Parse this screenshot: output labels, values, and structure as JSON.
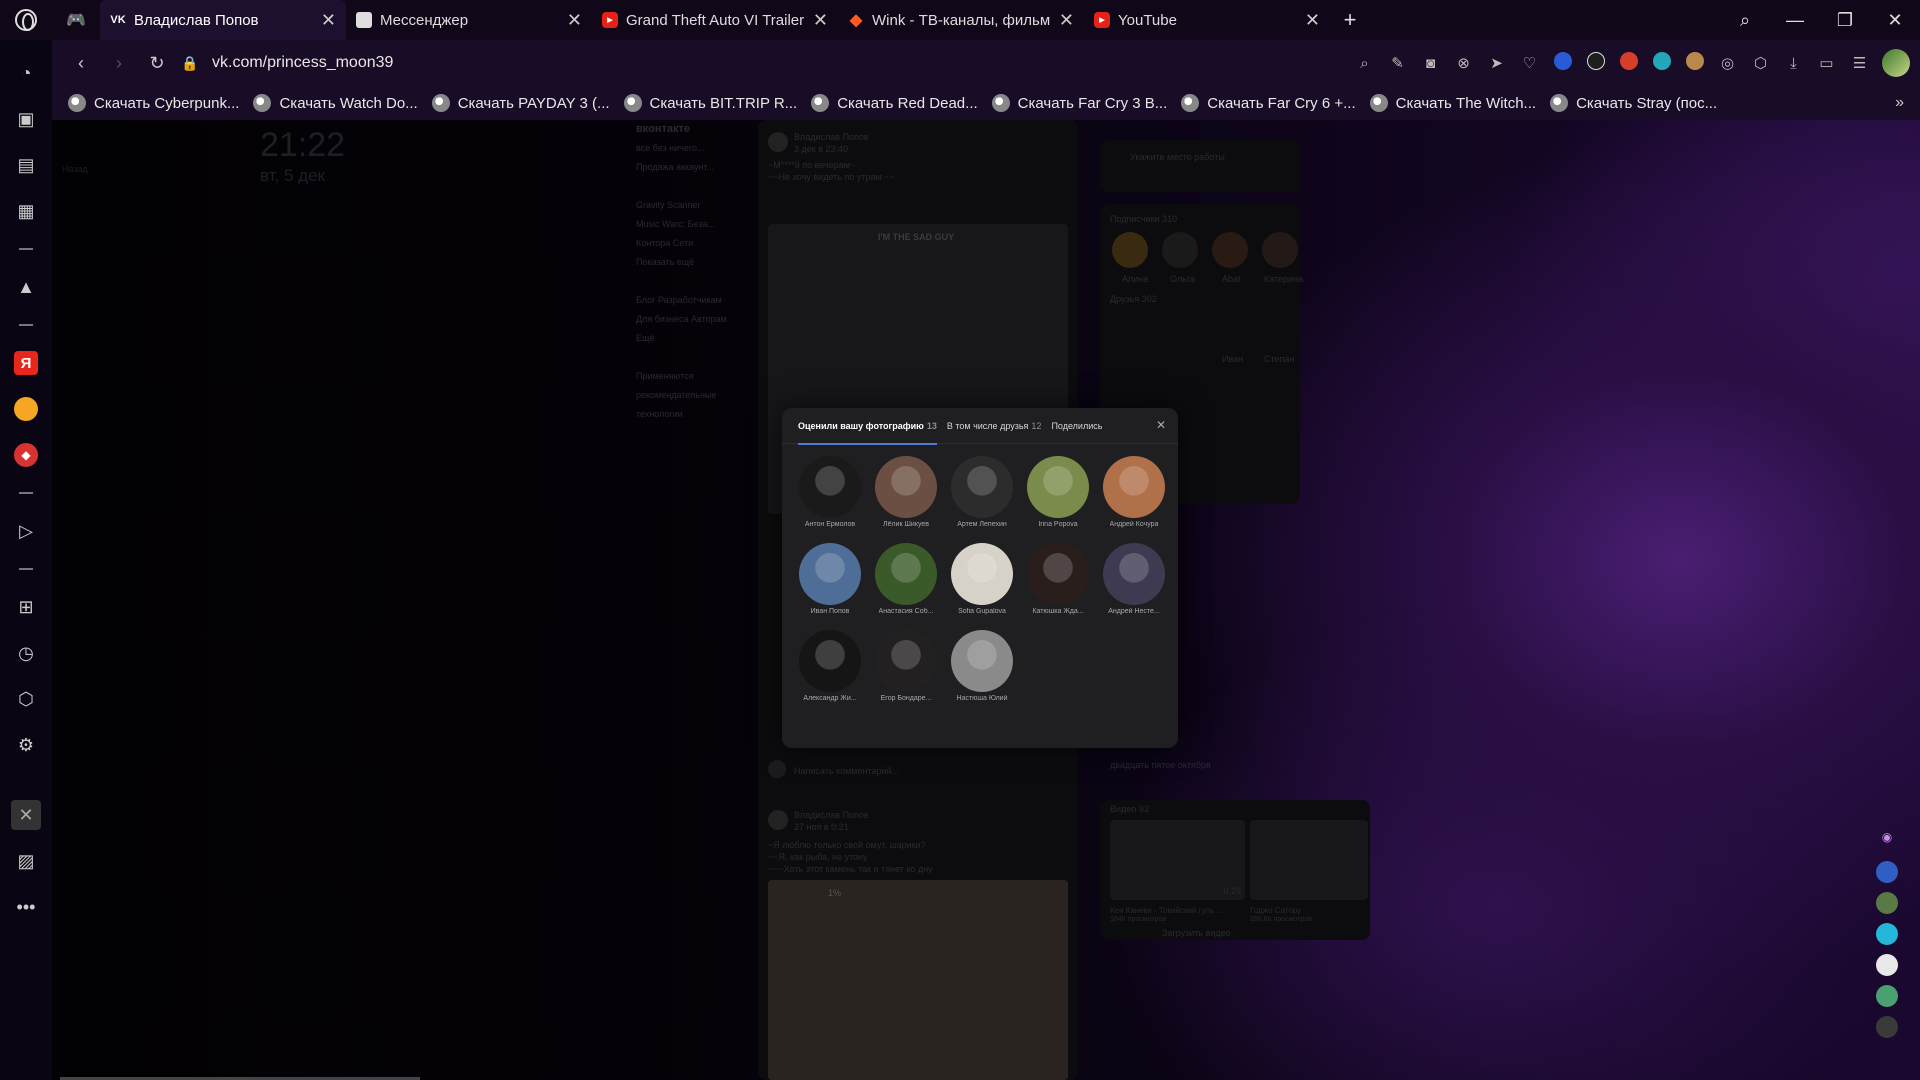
{
  "tabs": [
    {
      "label": "Владислав Попов",
      "favicon": "vk-icon",
      "active": true
    },
    {
      "label": "Мессенджер",
      "favicon": "messenger-icon",
      "active": false
    },
    {
      "label": "Grand Theft Auto VI Trailer",
      "favicon": "youtube-icon",
      "active": false
    },
    {
      "label": "Wink - ТВ-каналы, фильмы",
      "favicon": "wink-icon",
      "active": false
    },
    {
      "label": "YouTube",
      "favicon": "youtube-icon",
      "active": false
    }
  ],
  "address": {
    "url": "vk.com/princess_moon39"
  },
  "bookmarks": [
    "Скачать Cyberpunk...",
    "Скачать Watch Do...",
    "Скачать PAYDAY 3 (...",
    "Скачать BIT.TRIP R...",
    "Скачать Red Dead...",
    "Скачать Far Cry 3 B...",
    "Скачать Far Cry 6 +...",
    "Скачать The Witch...",
    "Скачать Stray (пос..."
  ],
  "page": {
    "clock": "21:22",
    "date": "вт, 5 дек",
    "back": "Назад"
  },
  "vk_left_menu": [
    "вконтакте",
    "все без ничего...",
    "Продажа аккаунт...",
    "",
    "Gravity Scanner",
    "Music Warc: Беза...",
    "Контора Сети",
    "Показать ещё",
    "",
    "Блог  Разработчикам",
    "Для бизнеса  Авторам",
    "Ещё",
    "",
    "Применяются",
    "рекомендательные",
    "технологии"
  ],
  "vk_right": {
    "work_prompt": "Укажите место работы",
    "followers_label": "Подписчики",
    "followers_count": "310",
    "followers": [
      "Алина",
      "Ольга",
      "Abat",
      "Катерина"
    ],
    "friends_label": "Друзья",
    "friends_count": "302",
    "friends": [
      "",
      "",
      "Иван",
      "Степан"
    ],
    "video_label": "Видео",
    "video_count": "93",
    "videos": [
      {
        "title": "Кен Канеки - Токийский гуль ...",
        "views": "164К просмотров",
        "duration": "0:29"
      },
      {
        "title": "Годжо Сатору",
        "views": "286,6К просмотров",
        "duration": ""
      }
    ],
    "upload_video": "Загрузить видео",
    "misc_date": "двадцать пятое октября"
  },
  "posts": [
    {
      "author": "Владислав Попов",
      "date": "3 дек в 23:40",
      "text1": "~М****й по вечерам~",
      "text2": "~~Не хочу видеть по утрам ~~",
      "image_caption": "I'M THE SAD GUY"
    },
    {
      "author": "Владислав Попов",
      "date": "27 ноя в 0:21",
      "text1": "~Я люблю только свой омут, шарики?",
      "text2": "~~Я, как рыба, не утону",
      "text3": "~~~Хоть этот камень так и тянет ко дну",
      "image_caption": "1%"
    }
  ],
  "comment_placeholder": "Написать комментарий...",
  "modal": {
    "tabs": [
      {
        "label": "Оценили вашу фотографию",
        "count": "13",
        "active": true
      },
      {
        "label": "В том числе друзья",
        "count": "12",
        "active": false
      },
      {
        "label": "Поделились",
        "count": "",
        "active": false
      }
    ],
    "people": [
      {
        "name": "Антон Ермолов",
        "color": "#1a1a1a"
      },
      {
        "name": "Лёлик Шикуев",
        "color": "#6b4f43"
      },
      {
        "name": "Артем Лепехин",
        "color": "#2c2c2c"
      },
      {
        "name": "Irina Popova",
        "color": "#7a8b4c"
      },
      {
        "name": "Андрей Кочура",
        "color": "#b0704a"
      },
      {
        "name": "Иван Попов",
        "color": "#4f6e97"
      },
      {
        "name": "Анастасия Соб...",
        "color": "#3b5a2a"
      },
      {
        "name": "Sofia Gupalova",
        "color": "#d7d2c8"
      },
      {
        "name": "Катюшка Жда...",
        "color": "#2a1e1c"
      },
      {
        "name": "Андрей Несте...",
        "color": "#3e3a52"
      },
      {
        "name": "Александр Жи...",
        "color": "#151515"
      },
      {
        "name": "Егор Бондаре...",
        "color": "#222020"
      },
      {
        "name": "Настюша Юлий",
        "color": "#8a8a8a"
      }
    ]
  }
}
